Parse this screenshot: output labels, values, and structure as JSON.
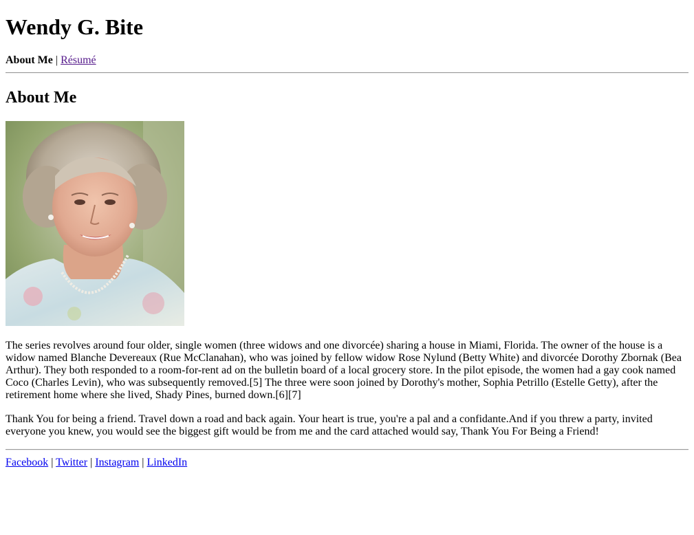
{
  "site_title": "Wendy G. Bite",
  "nav": {
    "current": "About Me",
    "separator": "|",
    "resume_link": "Résumé"
  },
  "section_heading": "About Me",
  "photo": {
    "description_icon": "portrait-photo"
  },
  "paragraphs": [
    "The series revolves around four older, single women (three widows and one divorcée) sharing a house in Miami, Florida. The owner of the house is a widow named Blanche Devereaux (Rue McClanahan), who was joined by fellow widow Rose Nylund (Betty White) and divorcée Dorothy Zbornak (Bea Arthur). They both responded to a room-for-rent ad on the bulletin board of a local grocery store. In the pilot episode, the women had a gay cook named Coco (Charles Levin), who was subsequently removed.[5] The three were soon joined by Dorothy's mother, Sophia Petrillo (Estelle Getty), after the retirement home where she lived, Shady Pines, burned down.[6][7]",
    "Thank You for being a friend. Travel down a road and back again. Your heart is true, you're a pal and a confidante.And if you threw a party, invited everyone you knew, you would see the biggest gift would be from me and the card attached would say, Thank You For Being a Friend!"
  ],
  "footer": {
    "links": [
      "Facebook",
      "Twitter",
      "Instagram",
      "LinkedIn"
    ],
    "separator": "|"
  },
  "colors": {
    "link": "#0000ee",
    "visited_link": "#551a8b",
    "text": "#000000",
    "background": "#ffffff"
  }
}
